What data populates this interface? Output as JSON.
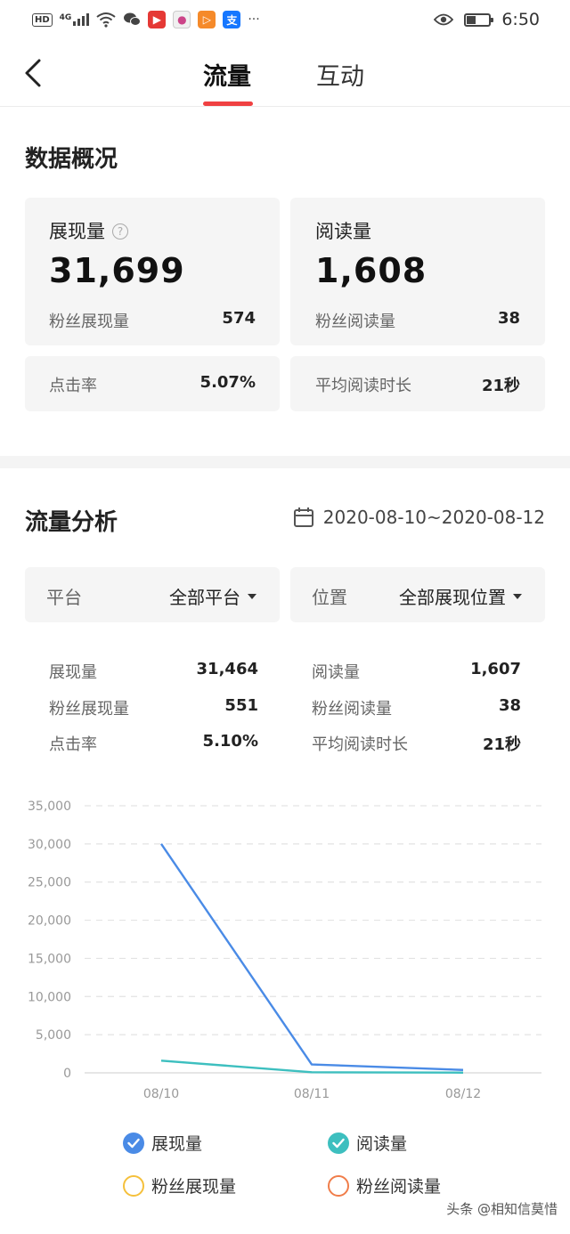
{
  "status_bar": {
    "hd": "HD",
    "network": "4G",
    "alipay_char": "支",
    "more": "···",
    "time": "6:50",
    "battery_level": 0.4
  },
  "nav": {
    "tabs": [
      {
        "label": "流量",
        "active": true
      },
      {
        "label": "互动",
        "active": false
      }
    ],
    "accent": "#f04142"
  },
  "overview": {
    "title": "数据概况",
    "impressions": {
      "label": "展现量",
      "value": "31,699",
      "fan_label": "粉丝展现量",
      "fan_value": "574"
    },
    "reads": {
      "label": "阅读量",
      "value": "1,608",
      "fan_label": "粉丝阅读量",
      "fan_value": "38"
    },
    "ctr": {
      "label": "点击率",
      "value": "5.07%"
    },
    "avg_time": {
      "label": "平均阅读时长",
      "value": "21秒"
    }
  },
  "analysis": {
    "title": "流量分析",
    "date_range": "2020-08-10~2020-08-12",
    "platform": {
      "label": "平台",
      "value": "全部平台"
    },
    "position": {
      "label": "位置",
      "value": "全部展现位置"
    },
    "stats": {
      "impressions": {
        "label": "展现量",
        "value": "31,464"
      },
      "fan_impressions": {
        "label": "粉丝展现量",
        "value": "551"
      },
      "ctr": {
        "label": "点击率",
        "value": "5.10%"
      },
      "reads": {
        "label": "阅读量",
        "value": "1,607"
      },
      "fan_reads": {
        "label": "粉丝阅读量",
        "value": "38"
      },
      "avg_time": {
        "label": "平均阅读时长",
        "value": "21秒"
      }
    }
  },
  "chart_data": {
    "type": "line",
    "x": [
      "08/10",
      "08/11",
      "08/12"
    ],
    "ylim": [
      0,
      35000
    ],
    "yticks": [
      "0",
      "5,000",
      "10,000",
      "15,000",
      "20,000",
      "25,000",
      "30,000",
      "35,000"
    ],
    "ytick_values": [
      0,
      5000,
      10000,
      15000,
      20000,
      25000,
      30000,
      35000
    ],
    "grid": true,
    "series": [
      {
        "name": "展现量",
        "values": [
          30000,
          1100,
          380
        ],
        "color": "#4a8be6",
        "checked": true
      },
      {
        "name": "阅读量",
        "values": [
          1600,
          80,
          30
        ],
        "color": "#3dbfbf",
        "checked": true
      },
      {
        "name": "粉丝展现量",
        "values": [
          null,
          null,
          null
        ],
        "color": "#f5c03b",
        "checked": false
      },
      {
        "name": "粉丝阅读量",
        "values": [
          null,
          null,
          null
        ],
        "color": "#f07d4a",
        "checked": false
      }
    ]
  },
  "watermark": "头条 @相知信莫惜"
}
